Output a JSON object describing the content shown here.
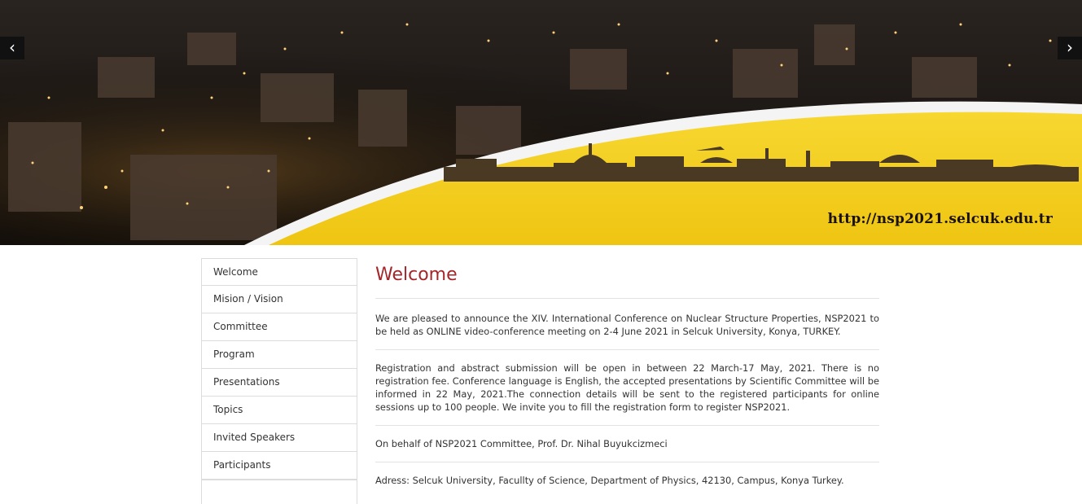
{
  "banner": {
    "url_text": "http://nsp2021.selcuk.edu.tr",
    "prev_arrow": "‹",
    "next_arrow": "›"
  },
  "sidebar": {
    "items": [
      {
        "label": "Welcome"
      },
      {
        "label": "Mision / Vision"
      },
      {
        "label": "Committee"
      },
      {
        "label": "Program"
      },
      {
        "label": "Presentations"
      },
      {
        "label": "Topics"
      },
      {
        "label": "Invited Speakers"
      },
      {
        "label": "Participants"
      }
    ]
  },
  "main": {
    "title": "Welcome",
    "paragraphs": [
      "We are pleased to announce the XIV. International Conference on Nuclear Structure Properties, NSP2021 to be held as ONLINE video-conference meeting on 2-4 June 2021 in Selcuk University, Konya, TURKEY.",
      "Registration and abstract submission will be open in between 22 March-17 May, 2021. There is no registration fee. Conference language is English, the accepted presentations by Scientific Committee will be informed in 22 May, 2021.The connection details will be sent to the registered participants for online sessions up to 100 people. We invite you to fill the registration form to register NSP2021.",
      "On behalf of NSP2021 Committee, Prof. Dr. Nihal Buyukcizmeci",
      "Adress: Selcuk University, Facullty of Science, Department of Physics, 42130, Campus, Konya Turkey."
    ]
  },
  "colors": {
    "accent": "#a5262a",
    "banner_yellow": "#f3cf1b",
    "border": "#dcdcdc"
  }
}
